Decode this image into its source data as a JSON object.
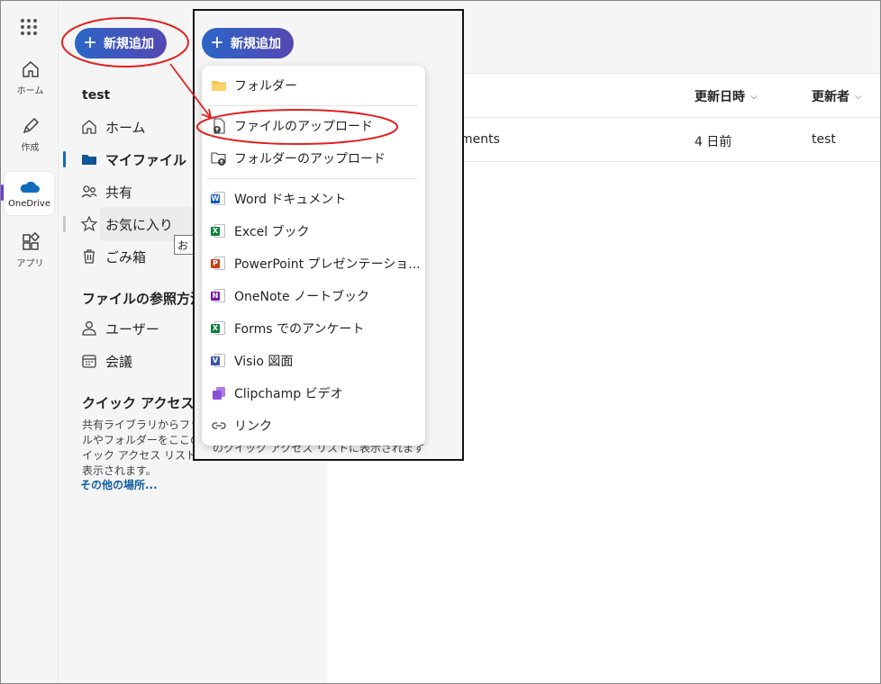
{
  "rail": {
    "items": [
      {
        "label": "ホーム",
        "icon": "home-icon"
      },
      {
        "label": "作成",
        "icon": "pen-icon"
      },
      {
        "label": "OneDrive",
        "icon": "onedrive-cloud-icon"
      },
      {
        "label": "アプリ",
        "icon": "apps-icon"
      }
    ]
  },
  "nav": {
    "new_button": "新規追加",
    "user": "test",
    "items": [
      {
        "label": "ホーム"
      },
      {
        "label": "マイファイル"
      },
      {
        "label": "共有"
      },
      {
        "label": "お気に入り"
      },
      {
        "label": "ごみ箱"
      }
    ],
    "tooltip": "お",
    "browse_heading": "ファイルの参照方法",
    "browse_items": [
      {
        "label": "ユーザー"
      },
      {
        "label": "会議"
      }
    ],
    "quick_access_heading": "クイック アクセス",
    "quick_access_text": "共有ライブラリからファイルやフォルダーをここのクイック アクセス リストに表示されます。",
    "more_places": "その他の場所..."
  },
  "main": {
    "columns": {
      "modified": "更新日時",
      "modified_by": "更新者"
    },
    "row": {
      "name": "ments",
      "modified": "4 日前",
      "modified_by": "test"
    }
  },
  "snapshot": {
    "new_button": "新規追加",
    "bg_text": "のクイック アクセス リストに表示されます",
    "menu": [
      {
        "label": "フォルダー",
        "icon": "folder-icon"
      },
      {
        "label": "ファイルのアップロード",
        "icon": "file-upload-icon"
      },
      {
        "label": "フォルダーのアップロード",
        "icon": "folder-upload-icon"
      },
      {
        "label": "Word ドキュメント",
        "icon": "word-icon",
        "color": "#185abd",
        "letter": "W"
      },
      {
        "label": "Excel ブック",
        "icon": "excel-icon",
        "color": "#107c41",
        "letter": "X"
      },
      {
        "label": "PowerPoint プレゼンテーショ...",
        "icon": "powerpoint-icon",
        "color": "#c43e1c",
        "letter": "P"
      },
      {
        "label": "OneNote ノートブック",
        "icon": "onenote-icon",
        "color": "#7719aa",
        "letter": "N"
      },
      {
        "label": "Forms でのアンケート",
        "icon": "forms-icon",
        "color": "#107c41",
        "letter": "X"
      },
      {
        "label": "Visio 図面",
        "icon": "visio-icon",
        "color": "#3955a3",
        "letter": "V"
      },
      {
        "label": "Clipchamp ビデオ",
        "icon": "clipchamp-icon",
        "color": "#8a4fd8",
        "letter": ""
      },
      {
        "label": "リンク",
        "icon": "link-icon"
      }
    ]
  },
  "colors": {
    "accent": "#0f6cbd",
    "annotation": "#e02020",
    "brand_gradient_start": "#2b66c8",
    "brand_gradient_end": "#5447b2"
  }
}
